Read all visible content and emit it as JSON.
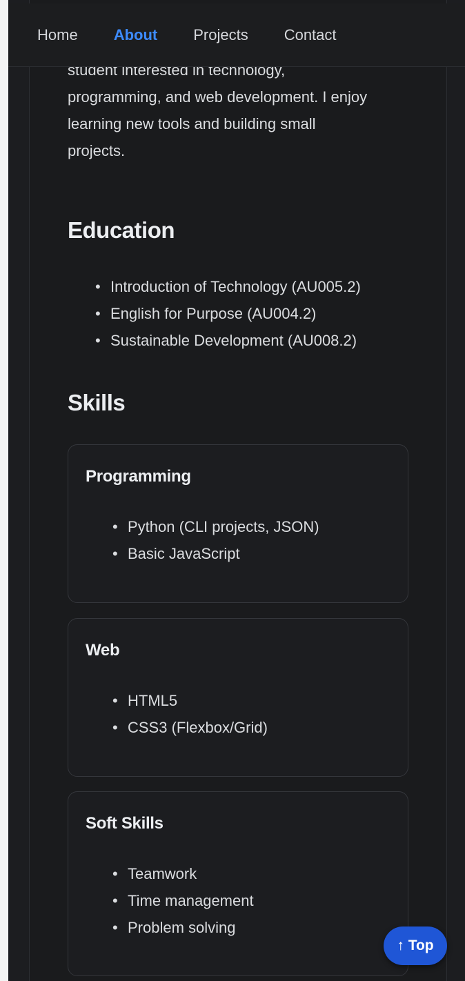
{
  "nav": {
    "items": [
      {
        "label": "Home",
        "active": false
      },
      {
        "label": "About",
        "active": true
      },
      {
        "label": "Projects",
        "active": false
      },
      {
        "label": "Contact",
        "active": false
      }
    ]
  },
  "about": {
    "intro_lines": [
      "student interested in technology,",
      "programming, and web development. I enjoy",
      "learning new tools and building small",
      "projects."
    ]
  },
  "education": {
    "title": "Education",
    "items": [
      "Introduction of Technology (AU005.2)",
      "English for Purpose (AU004.2)",
      "Sustainable Development (AU008.2)"
    ]
  },
  "skills": {
    "title": "Skills",
    "cards": [
      {
        "title": "Programming",
        "items": [
          "Python (CLI projects, JSON)",
          "Basic JavaScript"
        ]
      },
      {
        "title": "Web",
        "items": [
          "HTML5",
          "CSS3 (Flexbox/Grid)"
        ]
      },
      {
        "title": "Soft Skills",
        "items": [
          "Teamwork",
          "Time management",
          "Problem solving"
        ]
      }
    ]
  },
  "back_to_top": {
    "label": "↑ Top"
  },
  "colors": {
    "accent": "#3d8bff",
    "button": "#1f56d6",
    "background": "#1a1b1d"
  }
}
